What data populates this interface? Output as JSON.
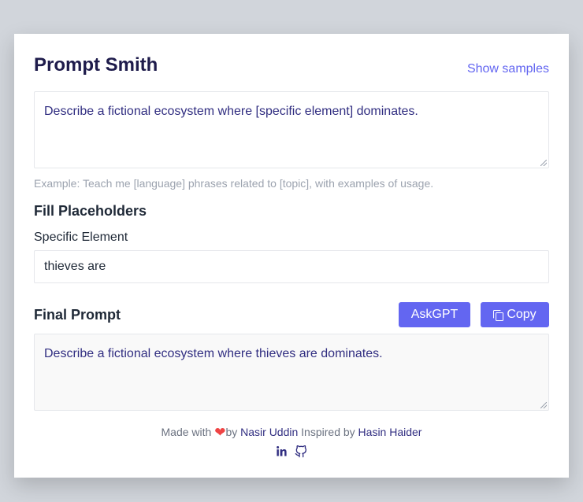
{
  "app": {
    "title": "Prompt Smith",
    "show_samples_label": "Show samples"
  },
  "prompt": {
    "text": "Describe a fictional ecosystem where [specific element] dominates.",
    "example": "Example: Teach me [language] phrases related to [topic], with examples of usage."
  },
  "placeholders": {
    "heading": "Fill Placeholders",
    "fields": [
      {
        "label": "Specific Element",
        "value": "thieves are"
      }
    ]
  },
  "final": {
    "heading": "Final Prompt",
    "askgpt_label": "AskGPT",
    "copy_label": "Copy",
    "text": "Describe a fictional ecosystem where thieves are dominates."
  },
  "footer": {
    "made_with": "Made with",
    "by": "by",
    "author": "Nasir Uddin",
    "inspired_by": "Inspired by",
    "inspirer": "Hasin Haider",
    "icons": [
      "heart-icon",
      "linkedin-icon",
      "github-icon",
      "copy-icon"
    ]
  },
  "colors": {
    "accent": "#6366f1",
    "heading": "#1e1b4b",
    "link": "#312e81",
    "background": "#d1d5db"
  }
}
